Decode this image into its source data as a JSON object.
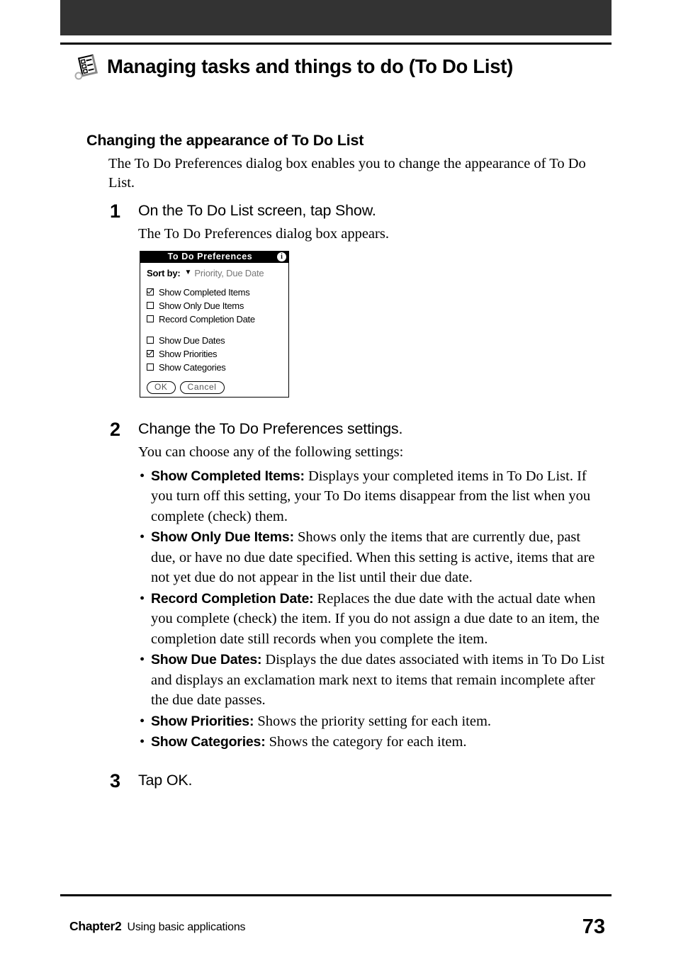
{
  "page": {
    "number": "73",
    "banner_color": "#333333"
  },
  "header": {
    "icon": "todo-list-icon",
    "title": "Managing tasks and things to do (To Do List)"
  },
  "section": {
    "heading": "Changing the appearance of To Do List",
    "intro": "The To Do Preferences dialog box enables you to change the appearance of To Do List."
  },
  "steps": [
    {
      "number": "1",
      "title": "On the To Do List screen, tap Show.",
      "sub": "The To Do Preferences dialog box appears."
    },
    {
      "number": "2",
      "title": "Change the To Do Preferences settings.",
      "sub": "You can choose any of the following settings:"
    },
    {
      "number": "3",
      "title": "Tap OK.",
      "sub": ""
    }
  ],
  "settings_bullets": [
    {
      "term": "Show Completed Items:",
      "description": " Displays your completed items in To Do List. If you turn off this setting, your To Do items disappear from the list when you complete (check) them."
    },
    {
      "term": "Show Only Due Items:",
      "description": " Shows only the items that are currently due, past due, or have no due date specified. When this setting is active, items that are not yet due do not appear in the list until their due date."
    },
    {
      "term": "Record Completion Date:",
      "description": " Replaces the due date with the actual date when you complete (check) the item. If you do not assign a due date to an item, the completion date still records when you complete the item."
    },
    {
      "term": "Show Due Dates:",
      "description": " Displays the due dates associated with items in To Do List and displays an exclamation mark next to items that remain incomplete after the due date passes."
    },
    {
      "term": "Show Priorities:",
      "description": " Shows the priority setting for each item."
    },
    {
      "term": "Show Categories:",
      "description": " Shows the category for each item."
    }
  ],
  "dialog": {
    "title": "To Do Preferences",
    "info_icon": "info-icon",
    "sort_label": "Sort by:",
    "sort_caret": "▼",
    "sort_value": "Priority, Due Date",
    "group1": [
      {
        "label": "Show Completed Items",
        "checked": true
      },
      {
        "label": "Show Only Due Items",
        "checked": false
      },
      {
        "label": "Record Completion Date",
        "checked": false
      }
    ],
    "group2": [
      {
        "label": "Show Due Dates",
        "checked": false
      },
      {
        "label": "Show Priorities",
        "checked": true
      },
      {
        "label": "Show Categories",
        "checked": false
      }
    ],
    "ok_label": "OK",
    "cancel_label": "Cancel"
  },
  "footer": {
    "chapter": "Chapter2",
    "description": "Using basic applications",
    "page": "73"
  }
}
